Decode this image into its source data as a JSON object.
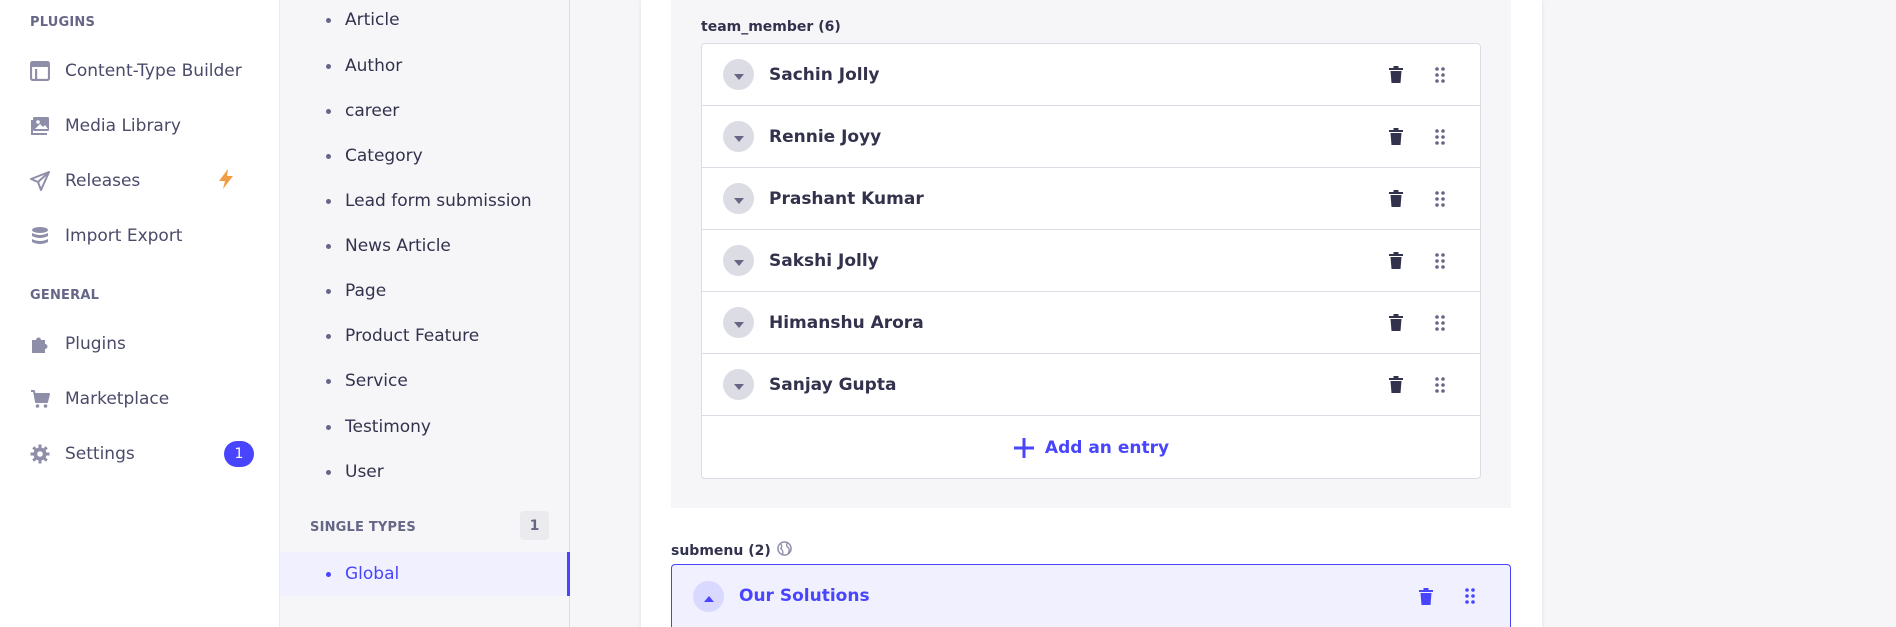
{
  "colors": {
    "accent": "#4945ff",
    "lightning": "#f29d41",
    "text": "#32324d",
    "muted": "#666687"
  },
  "mainnav": {
    "plugins_title": "PLUGINS",
    "general_title": "GENERAL",
    "plugins": [
      {
        "label": "Content-Type Builder",
        "icon": "layout-icon"
      },
      {
        "label": "Media Library",
        "icon": "image-icon"
      },
      {
        "label": "Releases",
        "icon": "paper-plane-icon",
        "extra_icon": "lightning-icon"
      },
      {
        "label": "Import Export",
        "icon": "database-icon"
      }
    ],
    "general": [
      {
        "label": "Plugins",
        "icon": "puzzle-icon"
      },
      {
        "label": "Marketplace",
        "icon": "cart-icon"
      },
      {
        "label": "Settings",
        "icon": "gear-icon",
        "badge": "1"
      }
    ]
  },
  "subnav": {
    "collection_types": [
      "Article",
      "Author",
      "career",
      "Category",
      "Lead form submission",
      "News Article",
      "Page",
      "Product Feature",
      "Service",
      "Testimony",
      "User"
    ],
    "single_types_title": "SINGLE TYPES",
    "single_types_count": "1",
    "single_types": [
      "Global"
    ]
  },
  "main": {
    "team_member_label": "team_member (6)",
    "team_members": [
      "Sachin Jolly",
      "Rennie Joyy",
      "Prashant Kumar",
      "Sakshi Jolly",
      "Himanshu Arora",
      "Sanjay Gupta"
    ],
    "add_entry_label": "Add an entry",
    "submenu_label": "submenu (2)",
    "submenu_open_item": "Our Solutions"
  }
}
